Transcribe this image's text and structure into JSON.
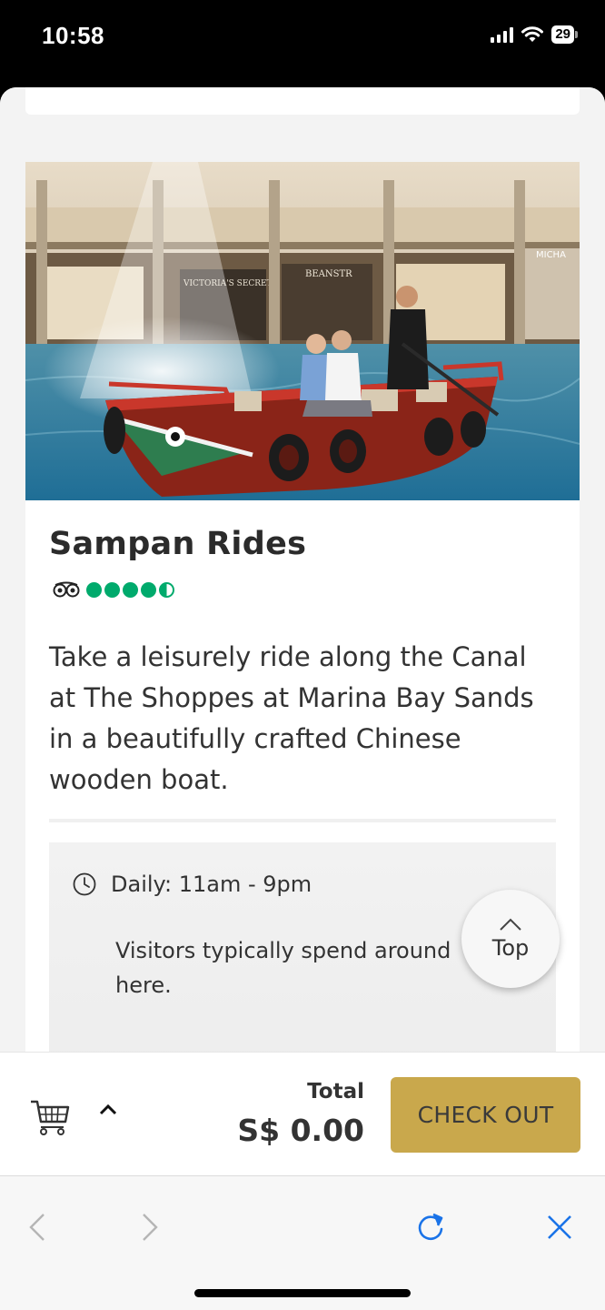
{
  "status_bar": {
    "time": "10:58",
    "battery": "29"
  },
  "attraction": {
    "title": "Sampan Rides",
    "rating_icon": "tripadvisor-owl-icon",
    "rating": 4.5,
    "rating_max": 5,
    "description": "Take a leisurely ride along the Canal at The Shoppes at Marina Bay Sands in a beautifully crafted Chinese wooden boat.",
    "hours": "Daily: 11am - 9pm",
    "visit_note": "Visitors typically spend around here."
  },
  "hero_image": {
    "signs": [
      "VICTORIA'S SECRET",
      "BEANSTR",
      "MICHA"
    ]
  },
  "scroll_top": {
    "label": "Top",
    "icon": "chevron-up-icon"
  },
  "cart": {
    "icon": "shopping-cart-icon",
    "expand_icon": "chevron-up-icon",
    "total_label": "Total",
    "total_value": "S$ 0.00",
    "checkout_label": "CHECK OUT"
  },
  "browser": {
    "back_icon": "chevron-left-icon",
    "forward_icon": "chevron-right-icon",
    "reload_icon": "reload-icon",
    "close_icon": "close-icon"
  },
  "colors": {
    "accent_gold": "#c9a84c",
    "rating_green": "#00aa6c",
    "browser_blue": "#1a73e8"
  }
}
